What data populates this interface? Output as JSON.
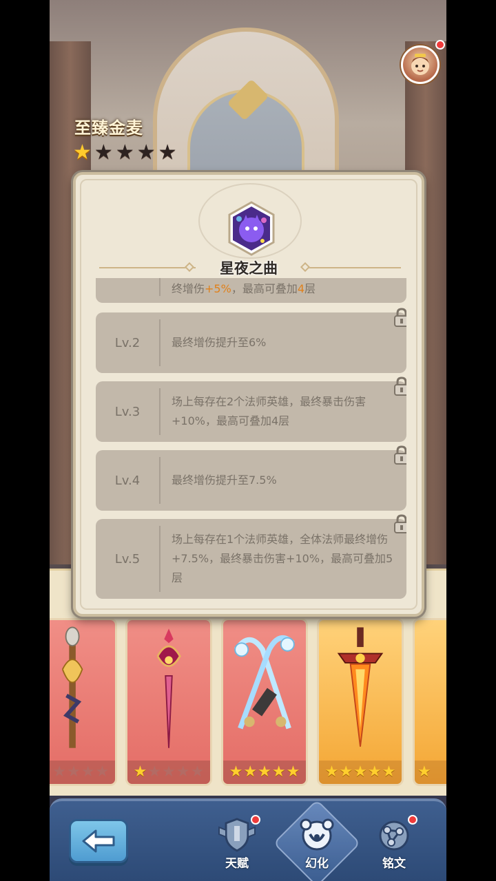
{
  "hero": {
    "name": "至臻金麦",
    "stars_total": 5,
    "stars_filled": 1
  },
  "popup": {
    "title": "星夜之曲",
    "icon": "purple-cat-orb-icon",
    "partial_row": {
      "text_before": "终增伤",
      "text_hl1": "+5%",
      "text_mid": "，最高可叠加",
      "text_hl2": "4",
      "text_after": "层"
    },
    "levels": [
      {
        "label": "Lv.2",
        "desc": "最终增伤提升至6%",
        "locked": true
      },
      {
        "label": "Lv.3",
        "desc": "场上每存在2个法师英雄，最终暴击伤害+10%，最高可叠加4层",
        "locked": true
      },
      {
        "label": "Lv.4",
        "desc": "最终增伤提升至7.5%",
        "locked": true
      },
      {
        "label": "Lv.5",
        "desc": "场上每存在1个法师英雄，全体法师最终增伤+7.5%，最终暴击伤害+10%，最高可叠加5层",
        "locked": true
      }
    ]
  },
  "cards": [
    {
      "weapon": "golden-staff-icon",
      "stars": 0,
      "color": "red"
    },
    {
      "weapon": "pink-scepter-icon",
      "stars": 1,
      "color": "red"
    },
    {
      "weapon": "ice-dragon-blades-icon",
      "stars": 5,
      "color": "red"
    },
    {
      "weapon": "flame-sword-icon",
      "stars": 5,
      "color": "gold"
    },
    {
      "weapon": "partial-card",
      "stars": 1,
      "color": "gold"
    }
  ],
  "bottom_bar": {
    "tabs": [
      {
        "label": "天赋",
        "icon": "talent-shield-icon",
        "badge": true
      },
      {
        "label": "幻化",
        "icon": "transform-bear-icon",
        "badge": false,
        "active": true
      },
      {
        "label": "铭文",
        "icon": "inscription-nodes-icon",
        "badge": true
      }
    ]
  },
  "colors": {
    "accent_orange": "#e0801a",
    "star_gold": "#ffcb2d",
    "badge_red": "#ef3b3b",
    "bar_blue": "#2d4a76"
  }
}
